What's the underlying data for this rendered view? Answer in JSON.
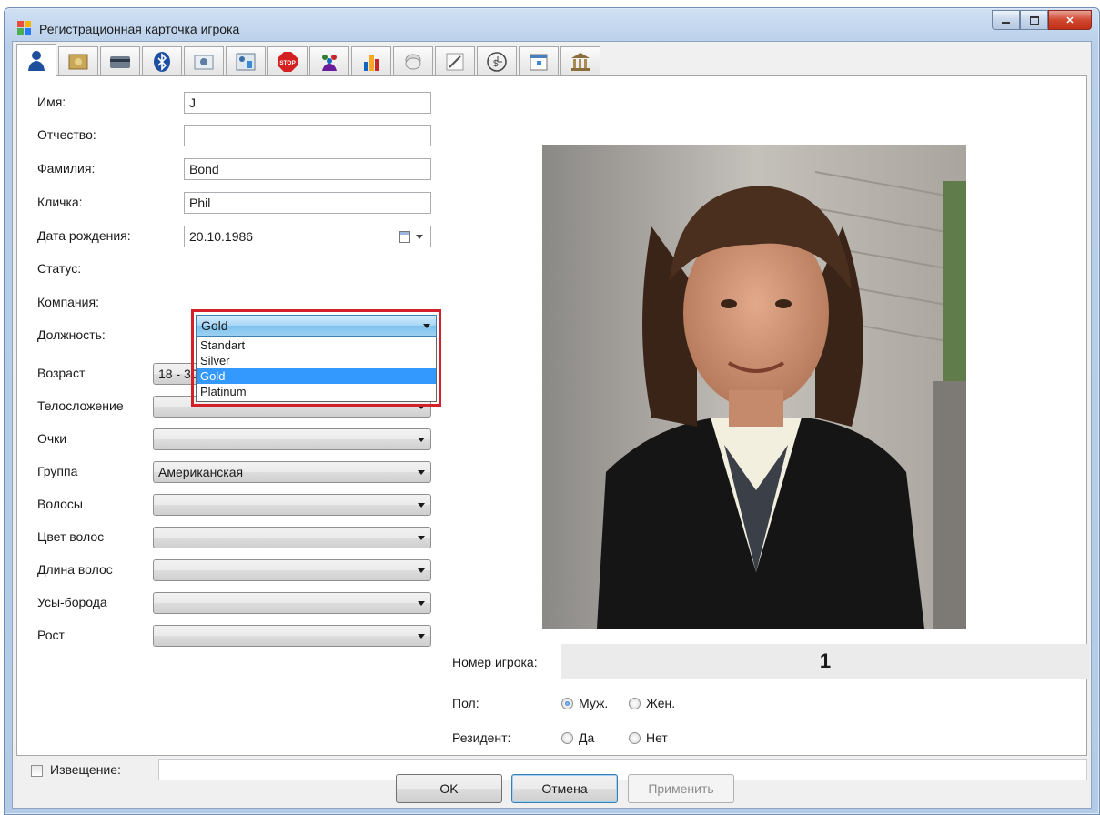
{
  "window": {
    "title": "Регистрационная карточка игрока"
  },
  "tabs": [
    {
      "icon": "person-icon"
    },
    {
      "icon": "folder-icon"
    },
    {
      "icon": "card-icon"
    },
    {
      "icon": "bluetooth-icon"
    },
    {
      "icon": "camera-icon"
    },
    {
      "icon": "id-card-icon"
    },
    {
      "icon": "stop-icon"
    },
    {
      "icon": "people-icon"
    },
    {
      "icon": "bar-chart-icon"
    },
    {
      "icon": "chip-icon"
    },
    {
      "icon": "pen-icon"
    },
    {
      "icon": "money-clock-icon"
    },
    {
      "icon": "calendar-icon"
    },
    {
      "icon": "bank-icon"
    }
  ],
  "form": {
    "first_name": {
      "label": "Имя:",
      "value": "J"
    },
    "middle_name": {
      "label": "Отчество:",
      "value": ""
    },
    "last_name": {
      "label": "Фамилия:",
      "value": "Bond"
    },
    "nickname": {
      "label": "Кличка:",
      "value": "Phil"
    },
    "birth_date": {
      "label": "Дата рождения:",
      "value": "20.10.1986"
    },
    "status": {
      "label": "Статус:",
      "value": "Gold",
      "options": [
        "Standart",
        "Silver",
        "Gold",
        "Platinum"
      ],
      "selected_index": 2
    },
    "company": {
      "label": "Компания:"
    },
    "position": {
      "label": "Должность:"
    },
    "age": {
      "label": "Возраст",
      "value": "18 - 30"
    },
    "build": {
      "label": "Телосложение",
      "value": ""
    },
    "glasses": {
      "label": "Очки",
      "value": ""
    },
    "group": {
      "label": "Группа",
      "value": "Американская"
    },
    "hair": {
      "label": "Волосы",
      "value": ""
    },
    "hair_color": {
      "label": "Цвет волос",
      "value": ""
    },
    "hair_length": {
      "label": "Длина волос",
      "value": ""
    },
    "mustache": {
      "label": "Усы-борода",
      "value": ""
    },
    "height": {
      "label": "Рост",
      "value": ""
    },
    "player_number": {
      "label": "Номер игрока:",
      "value": "1"
    },
    "gender": {
      "label": "Пол:",
      "male": "Муж.",
      "female": "Жен.",
      "selected": "male"
    },
    "resident": {
      "label": "Резидент:",
      "yes": "Да",
      "no": "Нет",
      "selected": null
    },
    "notice": {
      "label": "Извещение:",
      "checked": false,
      "value": ""
    }
  },
  "buttons": {
    "ok": "OK",
    "cancel": "Отмена",
    "apply": "Применить"
  },
  "colors": {
    "highlight": "#d3202b",
    "selection": "#3399ff"
  }
}
